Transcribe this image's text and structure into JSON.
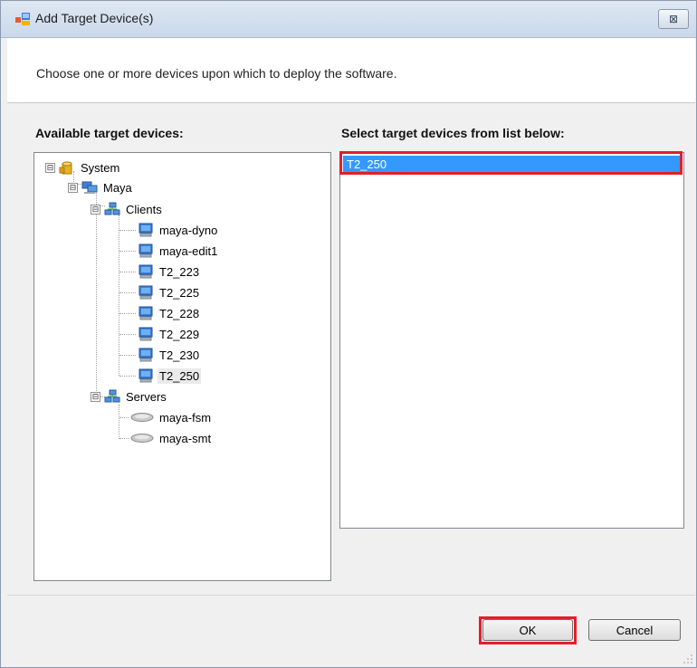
{
  "window": {
    "title": "Add Target Device(s)",
    "close_symbol": "⊠"
  },
  "header": {
    "instruction": "Choose one or more devices upon which to deploy the software."
  },
  "left_panel": {
    "label": "Available target devices:",
    "tree": {
      "root": {
        "label": "System",
        "expander": "⊟",
        "icon": "database-icon"
      },
      "site": {
        "label": "Maya",
        "expander": "⊟",
        "icon": "computers-icon"
      },
      "clients_group": {
        "label": "Clients",
        "expander": "⊟",
        "icon": "network-group-icon"
      },
      "clients": [
        "maya-dyno",
        "maya-edit1",
        "T2_223",
        "T2_225",
        "T2_228",
        "T2_229",
        "T2_230",
        "T2_250"
      ],
      "servers_group": {
        "label": "Servers",
        "expander": "⊟",
        "icon": "network-group-icon"
      },
      "servers": [
        "maya-fsm",
        "maya-smt"
      ],
      "selected": "T2_250"
    }
  },
  "right_panel": {
    "label": "Select target devices from list below:",
    "items": [
      "T2_250"
    ]
  },
  "buttons": {
    "ok_label": "OK",
    "cancel_label": "Cancel"
  },
  "colors": {
    "selection": "#3399ff",
    "highlight_border": "#e0202a"
  }
}
